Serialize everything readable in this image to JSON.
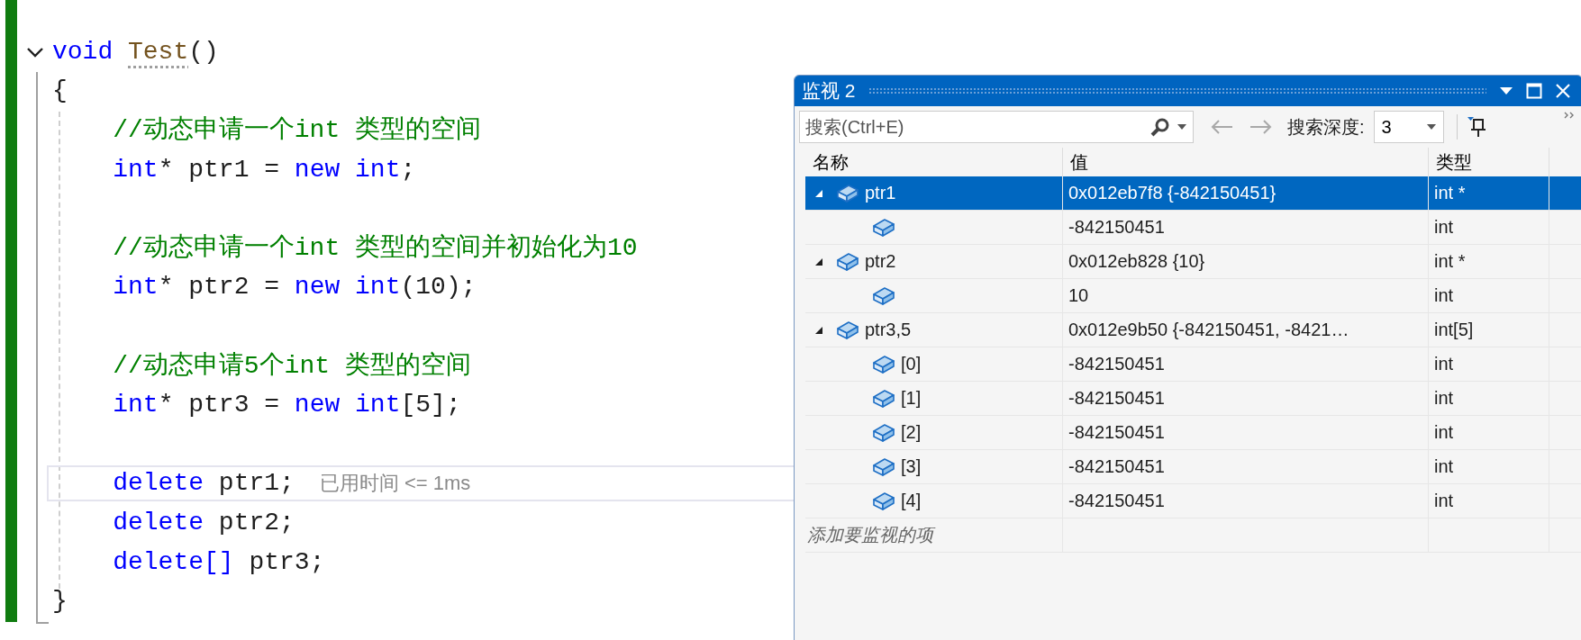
{
  "editor": {
    "lines": [
      {
        "fold_expanded": true,
        "current": false,
        "tokens": [
          {
            "kind": "keyword",
            "text": "void "
          },
          {
            "kind": "function",
            "text": "Test"
          },
          {
            "kind": "plain",
            "text": "()"
          }
        ]
      },
      {
        "current": false,
        "tokens": [
          {
            "kind": "plain",
            "text": "{"
          }
        ]
      },
      {
        "current": false,
        "tokens": [
          {
            "kind": "comment",
            "text": "    //动态申请一个int 类型的空间"
          }
        ]
      },
      {
        "current": false,
        "tokens": [
          {
            "kind": "keyword",
            "text": "    int"
          },
          {
            "kind": "plain",
            "text": "* ptr1 = "
          },
          {
            "kind": "keyword",
            "text": "new int"
          },
          {
            "kind": "plain",
            "text": ";"
          }
        ]
      },
      {
        "current": false
      },
      {
        "current": false,
        "tokens": [
          {
            "kind": "comment",
            "text": "    //动态申请一个int 类型的空间并初始化为10"
          }
        ]
      },
      {
        "current": false,
        "tokens": [
          {
            "kind": "keyword",
            "text": "    int"
          },
          {
            "kind": "plain",
            "text": "* ptr2 = "
          },
          {
            "kind": "keyword",
            "text": "new int"
          },
          {
            "kind": "plain",
            "text": "(10);"
          }
        ]
      },
      {
        "current": false
      },
      {
        "current": false,
        "tokens": [
          {
            "kind": "comment",
            "text": "    //动态申请5个int 类型的空间"
          }
        ]
      },
      {
        "current": false,
        "tokens": [
          {
            "kind": "keyword",
            "text": "    int"
          },
          {
            "kind": "plain",
            "text": "* ptr3 = "
          },
          {
            "kind": "keyword",
            "text": "new int"
          },
          {
            "kind": "plain",
            "text": "[5];"
          }
        ]
      },
      {
        "current": false
      },
      {
        "current": true,
        "tokens": [
          {
            "kind": "keyword",
            "text": "    delete"
          },
          {
            "kind": "plain",
            "text": " ptr1;"
          }
        ],
        "hint": "已用时间 <= 1ms"
      },
      {
        "current": false,
        "tokens": [
          {
            "kind": "keyword",
            "text": "    delete"
          },
          {
            "kind": "plain",
            "text": " ptr2;"
          }
        ]
      },
      {
        "current": false,
        "tokens": [
          {
            "kind": "keyword",
            "text": "    delete[]"
          },
          {
            "kind": "plain",
            "text": " ptr3;"
          }
        ]
      },
      {
        "current": false,
        "tokens": [
          {
            "kind": "plain",
            "text": "}"
          }
        ]
      }
    ]
  },
  "watch": {
    "title": "监视 2",
    "search": {
      "placeholder": "搜索(Ctrl+E)"
    },
    "depth_label": "搜索深度:",
    "depth_value": "3",
    "columns": [
      "名称",
      "值",
      "类型"
    ],
    "rows": [
      {
        "name": "ptr1",
        "value": "0x012eb7f8 {-842150451}",
        "type": "int *",
        "expanded": true,
        "selected": true,
        "children": [
          {
            "value": "-842150451",
            "type": "int",
            "selected": false
          }
        ]
      },
      {
        "name": "ptr2",
        "value": "0x012eb828 {10}",
        "type": "int *",
        "expanded": true,
        "selected": false,
        "children": [
          {
            "value": "10",
            "type": "int",
            "selected": false
          }
        ]
      },
      {
        "name": "ptr3,5",
        "value": "0x012e9b50 {-842150451, -8421…",
        "type": "int[5]",
        "expanded": true,
        "selected": false,
        "children": [
          {
            "name": "[0]",
            "value": "-842150451",
            "type": "int",
            "selected": false
          },
          {
            "name": "[1]",
            "value": "-842150451",
            "type": "int",
            "selected": false
          },
          {
            "name": "[2]",
            "value": "-842150451",
            "type": "int",
            "selected": false
          },
          {
            "name": "[3]",
            "value": "-842150451",
            "type": "int",
            "selected": false
          },
          {
            "name": "[4]",
            "value": "-842150451",
            "type": "int",
            "selected": false
          }
        ]
      }
    ],
    "add_placeholder": "添加要监视的项"
  }
}
